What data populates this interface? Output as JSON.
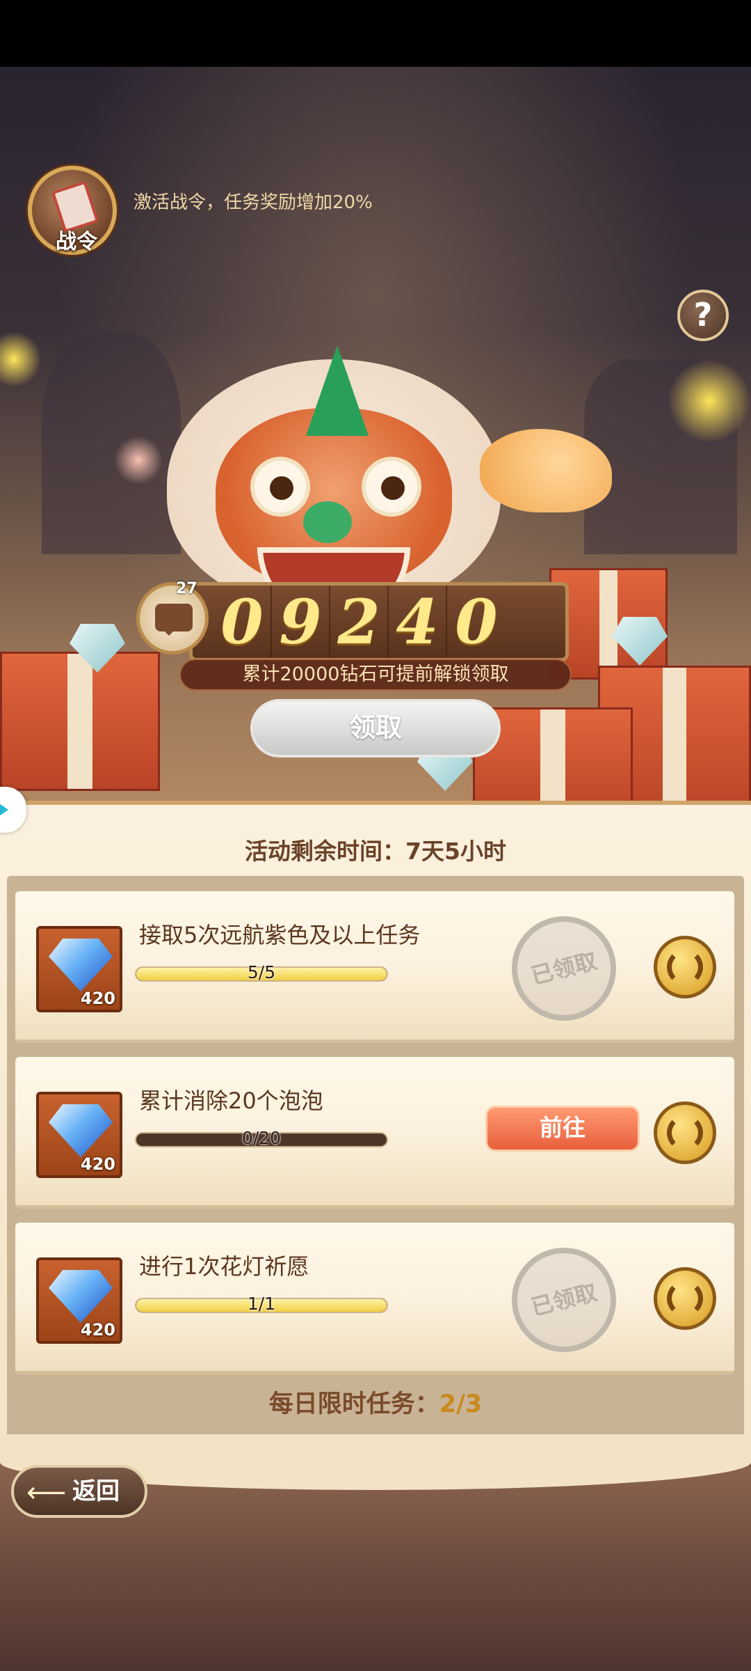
{
  "hero": {
    "pass_label": "战令",
    "pass_tip": "激活战令，任务奖励增加20%",
    "help_label": "?",
    "counter_digits": [
      "0",
      "9",
      "2",
      "4",
      "0"
    ],
    "chat_count": "27",
    "unlock_tip": "累计20000钻石可提前解锁领取",
    "claim_label": "领取"
  },
  "panel": {
    "remaining_time": "活动剩余时间：7天5小时",
    "tasks": [
      {
        "title": "接取5次远航紫色及以上任务",
        "reward_qty": "420",
        "progress_text": "5/5",
        "progress": 1.0,
        "status": "已领取",
        "refresh_icon": "refresh-icon"
      },
      {
        "title": "累计消除20个泡泡",
        "reward_qty": "420",
        "progress_text": "0/20",
        "progress": 0.0,
        "action_label": "前往",
        "refresh_icon": "refresh-icon"
      },
      {
        "title": "进行1次花灯祈愿",
        "reward_qty": "420",
        "progress_text": "1/1",
        "progress": 1.0,
        "status": "已领取",
        "refresh_icon": "refresh-icon"
      }
    ],
    "daily_label": "每日限时任务：",
    "daily_count": "2/3"
  },
  "footer": {
    "back_label": "返回",
    "back_icon": "arrow-left-icon"
  },
  "colors": {
    "accent_gold": "#f0cf42",
    "goto_orange": "#e8603c",
    "panel_cream": "#fbf1de"
  }
}
